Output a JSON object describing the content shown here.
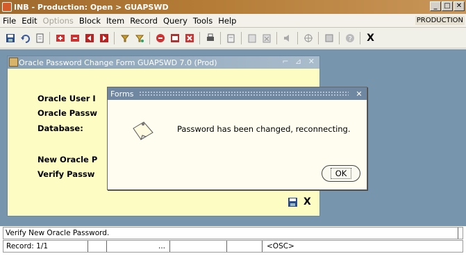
{
  "window": {
    "title": "INB - Production: Open > GUAPSWD",
    "env_label": "PRODUCTION"
  },
  "menu": {
    "items": [
      {
        "label": "File",
        "enabled": true
      },
      {
        "label": "Edit",
        "enabled": true
      },
      {
        "label": "Options",
        "enabled": false
      },
      {
        "label": "Block",
        "enabled": true
      },
      {
        "label": "Item",
        "enabled": true
      },
      {
        "label": "Record",
        "enabled": true
      },
      {
        "label": "Query",
        "enabled": true
      },
      {
        "label": "Tools",
        "enabled": true
      },
      {
        "label": "Help",
        "enabled": true
      }
    ]
  },
  "toolbar": {
    "buttons": [
      "save-icon",
      "rollback-icon",
      "document-icon",
      "insert-record-icon",
      "remove-record-icon",
      "previous-block-icon",
      "next-block-icon",
      "enter-query-icon",
      "execute-query-icon",
      "exit-icon",
      "cancel-query-icon",
      "print-icon",
      "clear-record-icon",
      "copy-icon",
      "paste-icon",
      "duplicate-icon",
      "speaker-icon",
      "target-icon",
      "help-book-icon",
      "help-icon",
      "close-icon"
    ]
  },
  "form": {
    "title": "Oracle Password Change Form  GUAPSWD  7.0  (Prod)",
    "labels": {
      "user_id": "Oracle User I",
      "password": "Oracle Passw",
      "database": "Database:",
      "new_password": "New Oracle P",
      "verify_password": "Verify Passw"
    },
    "save_symbol": "▣",
    "close_symbol": "X"
  },
  "dialog": {
    "title": "Forms",
    "message": "Password has been changed, reconnecting.",
    "ok_label": "OK",
    "close_symbol": "✕"
  },
  "status": {
    "hint": "Verify New Oracle Password.",
    "record": "Record: 1/1",
    "ellipsis": "...",
    "osc": "<OSC>"
  },
  "colors": {
    "workspace": "#7795ad",
    "form_background": "#fdfcc3",
    "title_accent": "#b47c36"
  }
}
